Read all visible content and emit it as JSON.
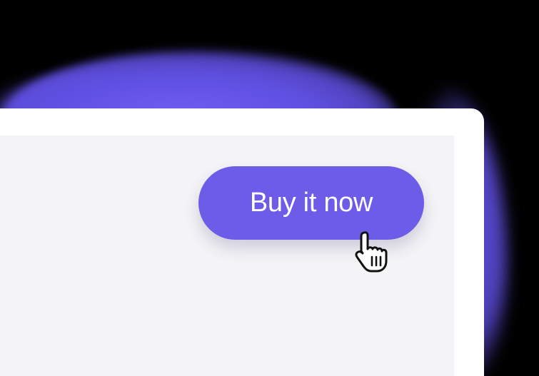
{
  "button": {
    "label": "Buy it now"
  },
  "colors": {
    "accent": "#6c5ce7",
    "glow": "#5f4fe0",
    "content_background": "#f4f4f7",
    "window_background": "#ffffff"
  },
  "icons": {
    "cursor": "hand-pointer-icon"
  }
}
